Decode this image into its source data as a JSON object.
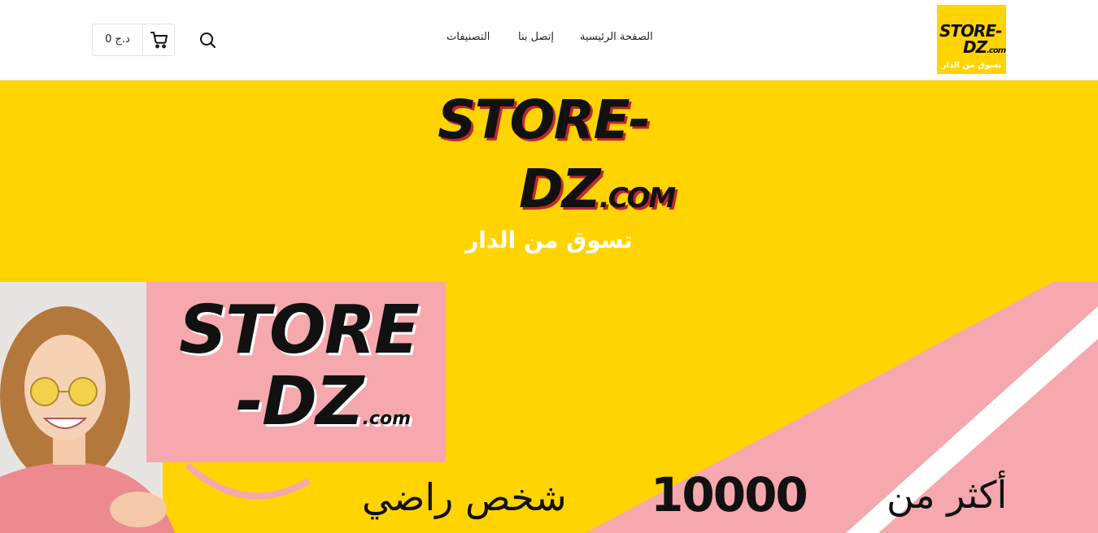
{
  "header": {
    "logo": {
      "line1": "STORE-",
      "line2": "DZ",
      "line2_suffix": ".com",
      "tagline": "تسوق من الدار"
    },
    "nav": {
      "home": "الصفحة الرئيسية",
      "contact": "إتصل بنا",
      "categories": "التصنيفات"
    },
    "cart": {
      "total": "0 د.ج"
    },
    "icons": {
      "search": "search-icon",
      "cart": "cart-icon"
    }
  },
  "hero": {
    "logo_line1": "STORE-",
    "logo_line2": "DZ",
    "logo_line2_suffix": ".COM",
    "tagline": "تسوق من الدار"
  },
  "banner": {
    "sign_line1": "STORE",
    "sign_line2": "-DZ",
    "sign_suffix": ".com",
    "promo_prefix": "أكثر من",
    "promo_number": "10000",
    "promo_suffix": "شخص راضي"
  },
  "colors": {
    "brand_yellow": "#ffd400",
    "brand_pink": "#f5a8ad",
    "text": "#111111"
  }
}
